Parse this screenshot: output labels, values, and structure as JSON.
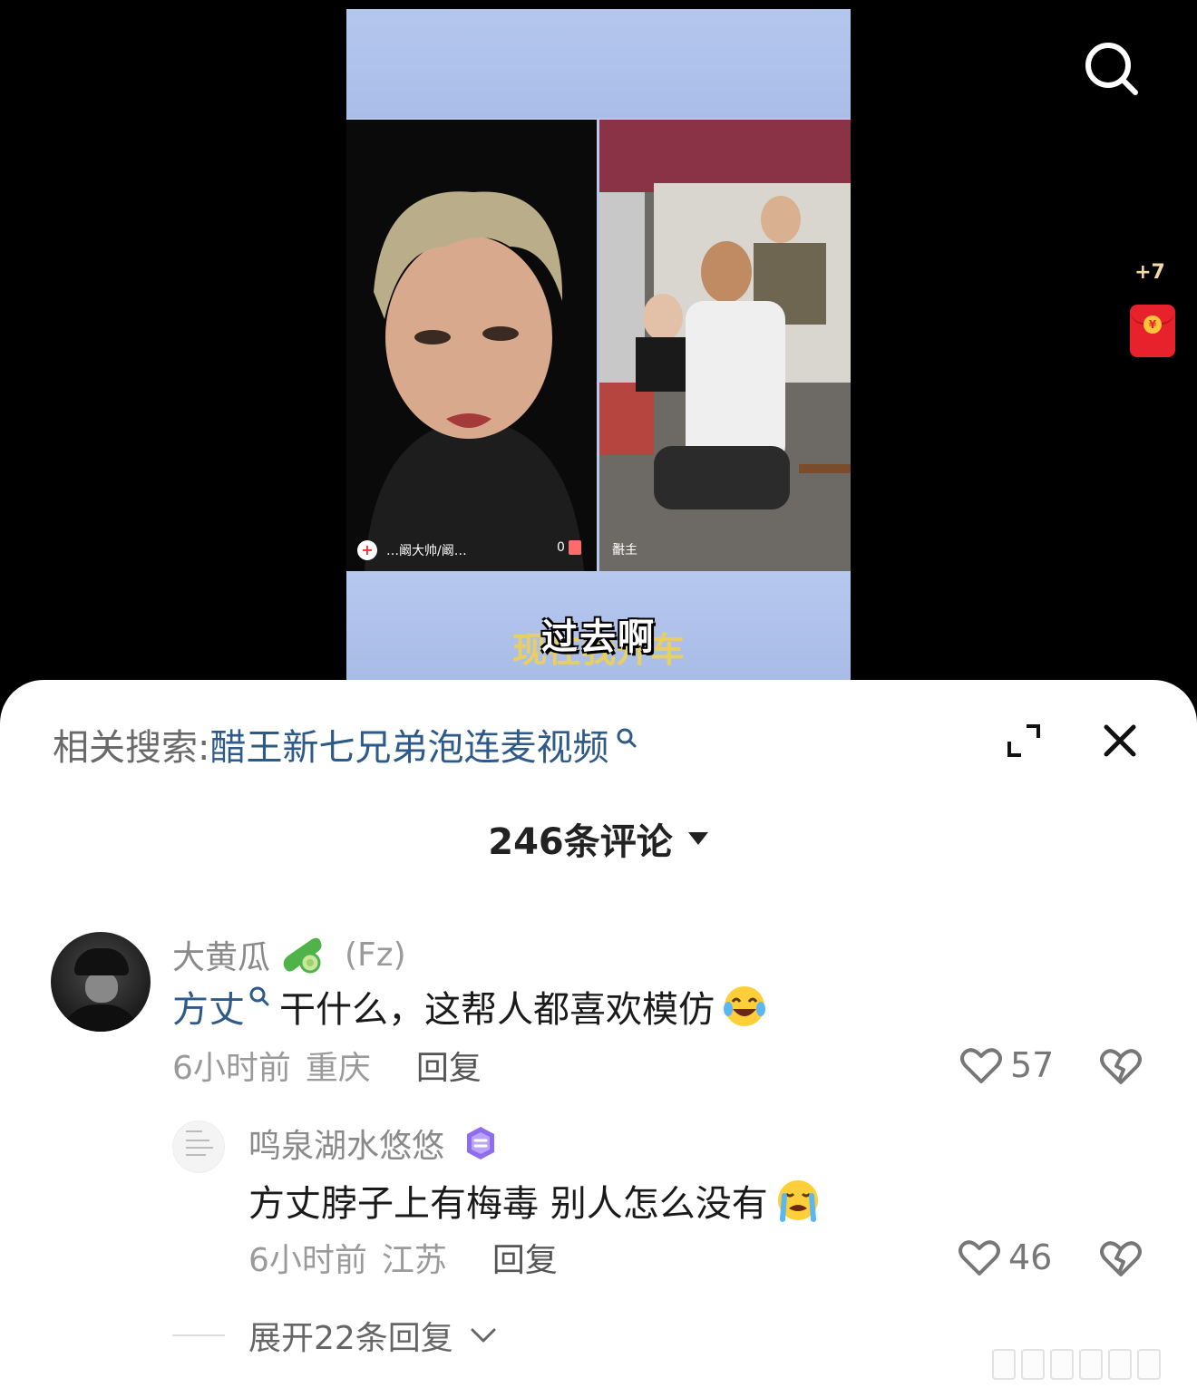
{
  "video": {
    "stream_left_name": "…阚大帅/阚…",
    "stream_left_plus": "+",
    "stream_gift_count": "0",
    "stream_right_tag": "主播",
    "caption": "过去啊",
    "caption_behind": "现在我开车"
  },
  "side": {
    "redpack_count": "+7",
    "redpack_coin": "¥",
    "search_icon": "search-icon",
    "redpack_icon": "red-envelope-icon"
  },
  "sheet": {
    "related_label": "相关搜索:",
    "related_query": "醋王新七兄弟泡连麦视频",
    "comment_count": "246条评论"
  },
  "comments": [
    {
      "username": "大黄瓜",
      "tag": "(Fz)",
      "mention": "方丈",
      "text": "干什么，这帮人都喜欢模仿",
      "time": "6小时前",
      "location": "重庆",
      "reply_label": "回复",
      "likes": "57"
    },
    {
      "username": "鸣泉湖水悠悠",
      "text": "方丈脖子上有梅毒 别人怎么没有",
      "time": "6小时前",
      "location": "江苏",
      "reply_label": "回复",
      "likes": "46"
    }
  ],
  "expand_replies": "展开22条回复",
  "colors": {
    "link": "#2e5a8a",
    "muted": "#9a9a9a",
    "redpack": "#e8222c",
    "badge": "#8f6df0"
  }
}
